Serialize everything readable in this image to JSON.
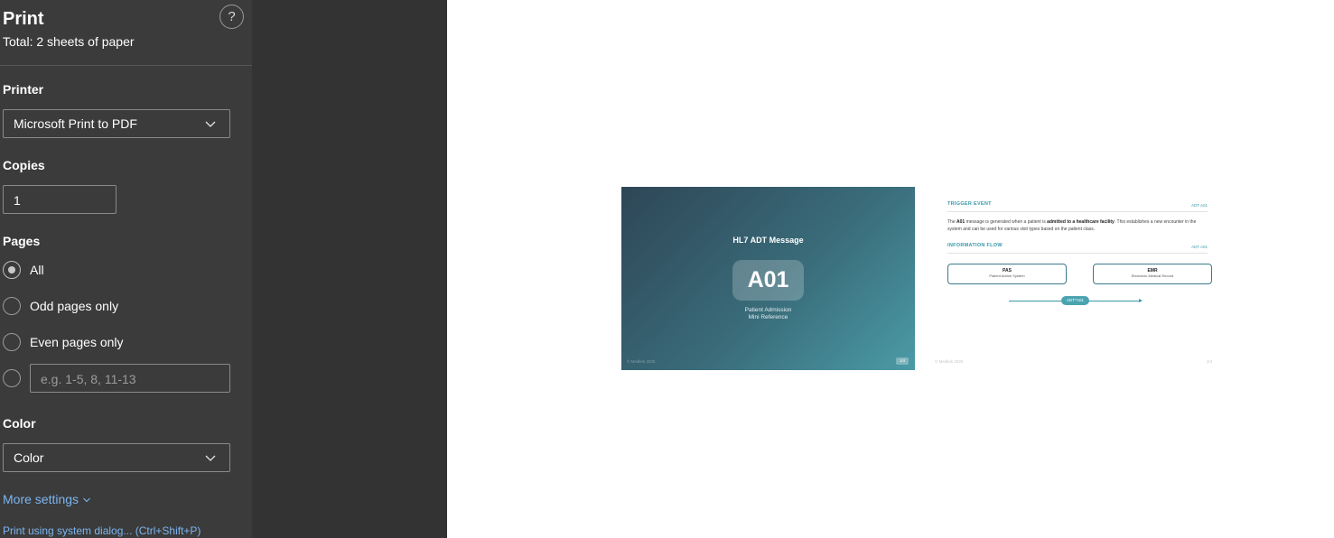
{
  "header": {
    "title": "Print",
    "subtitle": "Total: 2 sheets of paper",
    "help_label": "?"
  },
  "printer": {
    "label": "Printer",
    "selected": "Microsoft Print to PDF"
  },
  "copies": {
    "label": "Copies",
    "value": "1"
  },
  "pages": {
    "label": "Pages",
    "options": [
      "All",
      "Odd pages only",
      "Even pages only"
    ],
    "selected": "All",
    "custom_placeholder": "e.g. 1-5, 8, 11-13"
  },
  "color": {
    "label": "Color",
    "selected": "Color"
  },
  "more_settings": "More settings",
  "system_dialog": "Print using system dialog... (Ctrl+Shift+P)",
  "preview": {
    "page1": {
      "title": "HL7 ADT Message",
      "badge": "A01",
      "sub1": "Patient Admission",
      "sub2": "Mini Reference",
      "footer_left": "© Medlink 2025",
      "footer_right": "1/4"
    },
    "page2": {
      "section1_title": "TRIGGER EVENT",
      "section1_tag": "ADT A01",
      "body_1": "The ",
      "body_2": "A01",
      "body_3": " message is generated when a patient is ",
      "body_4": "admitted to a healthcare facility",
      "body_5": ". This establishes a new encounter in the system and can be used for various visit types based on the patient class.",
      "section2_title": "INFORMATION FLOW",
      "section2_tag": "ADT A01",
      "box1_title": "PAS",
      "box1_sub": "Patient Admin System",
      "box2_title": "EMR",
      "box2_sub": "Electronic Medical Record",
      "flow_pill": "ADT^A01",
      "footer_left": "© Medlink 2025",
      "footer_right": "2/4"
    }
  },
  "colors": {
    "panel_bg": "#3b3b3b",
    "gap_bg": "#333333",
    "link": "#7cb5f0",
    "accent": "#3a98a8"
  }
}
